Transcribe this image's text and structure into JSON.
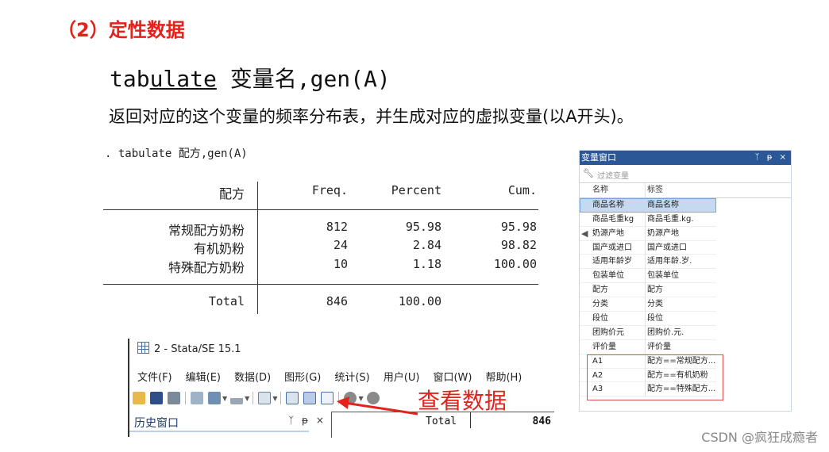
{
  "heading": "（2）定性数据",
  "command": {
    "pre": "tab",
    "underlined": "ulate",
    "rest": " 变量名,gen(A)"
  },
  "description": "返回对应的这个变量的频率分布表，并生成对应的虚拟变量(以A开头)。",
  "output": {
    "cmd_line": ". tabulate 配方,gen(A)",
    "headers": {
      "var": "配方",
      "freq": "Freq.",
      "percent": "Percent",
      "cum": "Cum."
    },
    "rows": [
      {
        "label": "常规配方奶粉",
        "freq": "812",
        "percent": "95.98",
        "cum": "95.98"
      },
      {
        "label": "有机奶粉",
        "freq": "24",
        "percent": "2.84",
        "cum": "98.82"
      },
      {
        "label": "特殊配方奶粉",
        "freq": "10",
        "percent": "1.18",
        "cum": "100.00"
      }
    ],
    "total": {
      "label": "Total",
      "freq": "846",
      "percent": "100.00"
    }
  },
  "variable_window": {
    "title": "变量窗口",
    "title_buttons": "ᛉ ᵽ ×",
    "filter_placeholder": "过滤变量",
    "col_name": "名称",
    "col_label": "标签",
    "rows": [
      {
        "name": "商品名称",
        "label": "商品名称"
      },
      {
        "name": "商品毛重kg",
        "label": "商品毛重.kg."
      },
      {
        "name": "奶源产地",
        "label": "奶源产地"
      },
      {
        "name": "国产或进口",
        "label": "国产或进口"
      },
      {
        "name": "适用年龄岁",
        "label": "适用年龄.岁."
      },
      {
        "name": "包装单位",
        "label": "包装单位"
      },
      {
        "name": "配方",
        "label": "配方"
      },
      {
        "name": "分类",
        "label": "分类"
      },
      {
        "name": "段位",
        "label": "段位"
      },
      {
        "name": "团购价元",
        "label": "团购价.元."
      },
      {
        "name": "评价量",
        "label": "评价量"
      },
      {
        "name": "A1",
        "label": "配方==常规配方..."
      },
      {
        "name": "A2",
        "label": "配方==有机奶粉"
      },
      {
        "name": "A3",
        "label": "配方==特殊配方..."
      }
    ]
  },
  "stata_window": {
    "title": "2 - Stata/SE 15.1",
    "menu": [
      "文件(F)",
      "编辑(E)",
      "数据(D)",
      "图形(G)",
      "统计(S)",
      "用户(U)",
      "窗口(W)",
      "帮助(H)"
    ],
    "history_label": "历史窗口",
    "history_buttons": "ᛉ ᵽ ×",
    "output_total_label": "Total",
    "output_total_value": "846"
  },
  "annotation": "查看数据",
  "watermark": "CSDN @疯狂成瘾者",
  "colors": {
    "heading": "#e3231b",
    "annotation": "#e3231b",
    "vw_title": "#2b5797",
    "highlight": "#c5d9f1"
  }
}
